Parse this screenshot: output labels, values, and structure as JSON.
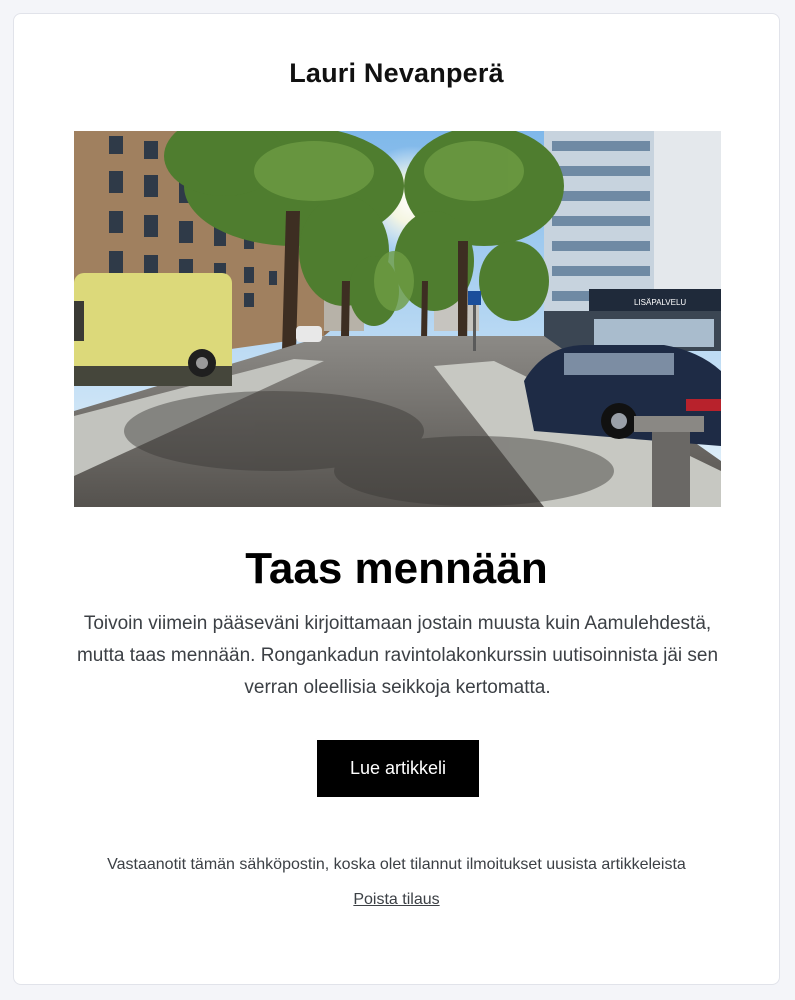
{
  "email": {
    "sender_name": "Lauri Nevanperä",
    "hero_image_alt": "",
    "article_title": "Taas mennään",
    "article_excerpt": "Toivoin viimein pääseväni kirjoittamaan jostain muusta kuin Aamulehdestä, mutta taas mennään. Rongankadun ravintolakonkurssin uutisoinnista jäi sen verran oleellisia seikkoja kertomatta.",
    "cta_label": "Lue artikkeli",
    "footer_notice": "Vastaanotit tämän sähköpostin, koska olet tilannut ilmoitukset uusista artikkeleista",
    "unsubscribe_label": "Poista tilaus"
  },
  "colors": {
    "page_background": "#f4f5f9",
    "card_background": "#ffffff",
    "button_background": "#000000",
    "button_text": "#ffffff",
    "body_text": "#3c4045"
  },
  "hero_photo": {
    "sign_text": "LISÄPALVELU"
  }
}
